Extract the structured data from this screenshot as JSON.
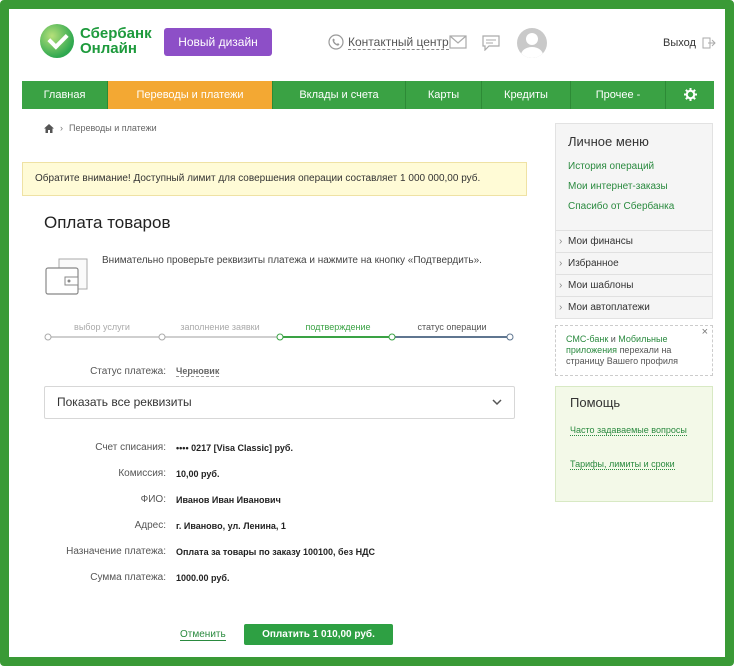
{
  "header": {
    "logo_line1": "Сбербанк",
    "logo_line2": "Онлайн",
    "new_design_label": "Новый дизайн",
    "contact_label": "Контактный центр",
    "logout_label": "Выход"
  },
  "nav": {
    "items": [
      {
        "label": "Главная"
      },
      {
        "label": "Переводы и платежи",
        "active": true
      },
      {
        "label": "Вклады и счета"
      },
      {
        "label": "Карты"
      },
      {
        "label": "Кредиты"
      },
      {
        "label": "Прочее -"
      }
    ]
  },
  "breadcrumb": {
    "label": "Переводы и платежи"
  },
  "notice": "Обратите внимание! Доступный лимит для совершения операции составляет 1 000 000,00 руб.",
  "page_title": "Оплата товаров",
  "intro_text": "Внимательно проверьте реквизиты платежа и нажмите на кнопку «Подтвердить».",
  "steps": [
    {
      "label": "выбор услуги",
      "state": "done"
    },
    {
      "label": "заполнение заявки",
      "state": "done"
    },
    {
      "label": "подтверждение",
      "state": "current"
    },
    {
      "label": "статус операции",
      "state": "next"
    }
  ],
  "status": {
    "label": "Статус платежа:",
    "value": "Черновик"
  },
  "details_toggle": "Показать все реквизиты",
  "details": [
    {
      "label": "Счет списания:",
      "value": "•••• 0217  [Visa Classic]  руб."
    },
    {
      "label": "Комиссия:",
      "value": "10,00 руб."
    },
    {
      "label": "ФИО:",
      "value": "Иванов Иван Иванович"
    },
    {
      "label": "Адрес:",
      "value": "г. Иваново, ул. Ленина, 1"
    },
    {
      "label": "Назначение платежа:",
      "value": "Оплата за товары по заказу 100100, без НДС"
    },
    {
      "label": "Сумма платежа:",
      "value": "1000.00 руб."
    }
  ],
  "actions": {
    "cancel": "Отменить",
    "pay": "Оплатить 1 010,00 руб."
  },
  "sidebar": {
    "personal_menu_title": "Личное меню",
    "links": [
      "История операций",
      "Мои интернет-заказы",
      "Спасибо от Сбербанка"
    ],
    "rows": [
      "Мои финансы",
      "Избранное",
      "Мои шаблоны",
      "Мои автоплатежи"
    ],
    "sms_link1": "СМС-банк",
    "sms_and": " и ",
    "sms_link2": "Мобильные приложения",
    "sms_text": " перехали на страницу Вашего профиля",
    "help_title": "Помощь",
    "help_link1": "Часто задаваемые вопросы",
    "help_link2": "Тарифы, лимиты и сроки"
  },
  "colors": {
    "brand_green": "#3aa244",
    "active_tab": "#f3a833",
    "new_design": "#8d4fc7",
    "frame": "#3a9a36"
  }
}
